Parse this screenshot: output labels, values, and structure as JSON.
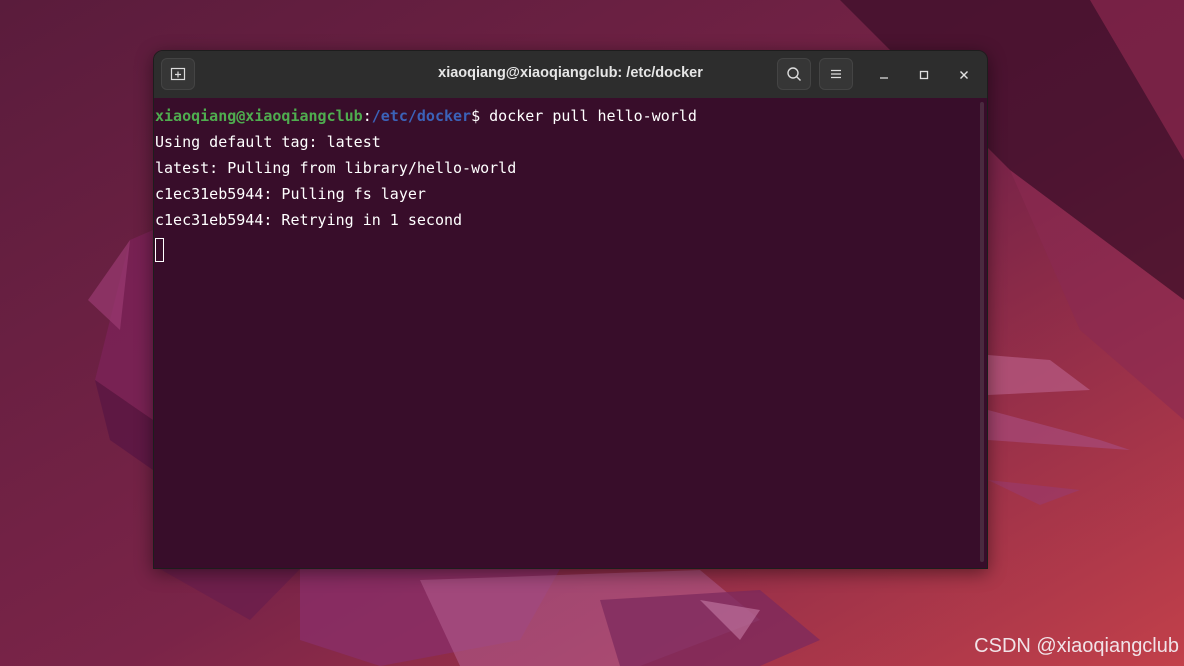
{
  "window": {
    "title": "xiaoqiang@xiaoqiangclub: /etc/docker"
  },
  "titlebar_icons": {
    "new_tab": "new-tab-icon",
    "search": "search-icon",
    "menu": "hamburger-menu-icon",
    "minimize": "minimize-icon",
    "maximize": "maximize-icon",
    "close": "close-icon"
  },
  "terminal": {
    "prompt": {
      "user_host": "xiaoqiang@xiaoqiangclub",
      "colon": ":",
      "path": "/etc/docker",
      "symbol": "$",
      "command": " docker pull hello-world"
    },
    "output": [
      "Using default tag: latest",
      "latest: Pulling from library/hello-world",
      "c1ec31eb5944: Pulling fs layer",
      "c1ec31eb5944: Retrying in 1 second"
    ]
  },
  "watermark": "CSDN @xiaoqiangclub",
  "colors": {
    "terminal_bg": "#380d2a",
    "titlebar_bg": "#2d2d2d",
    "prompt_user": "#4fad4f",
    "prompt_path": "#3b62b8",
    "wallpaper_base": "#6a2244"
  }
}
